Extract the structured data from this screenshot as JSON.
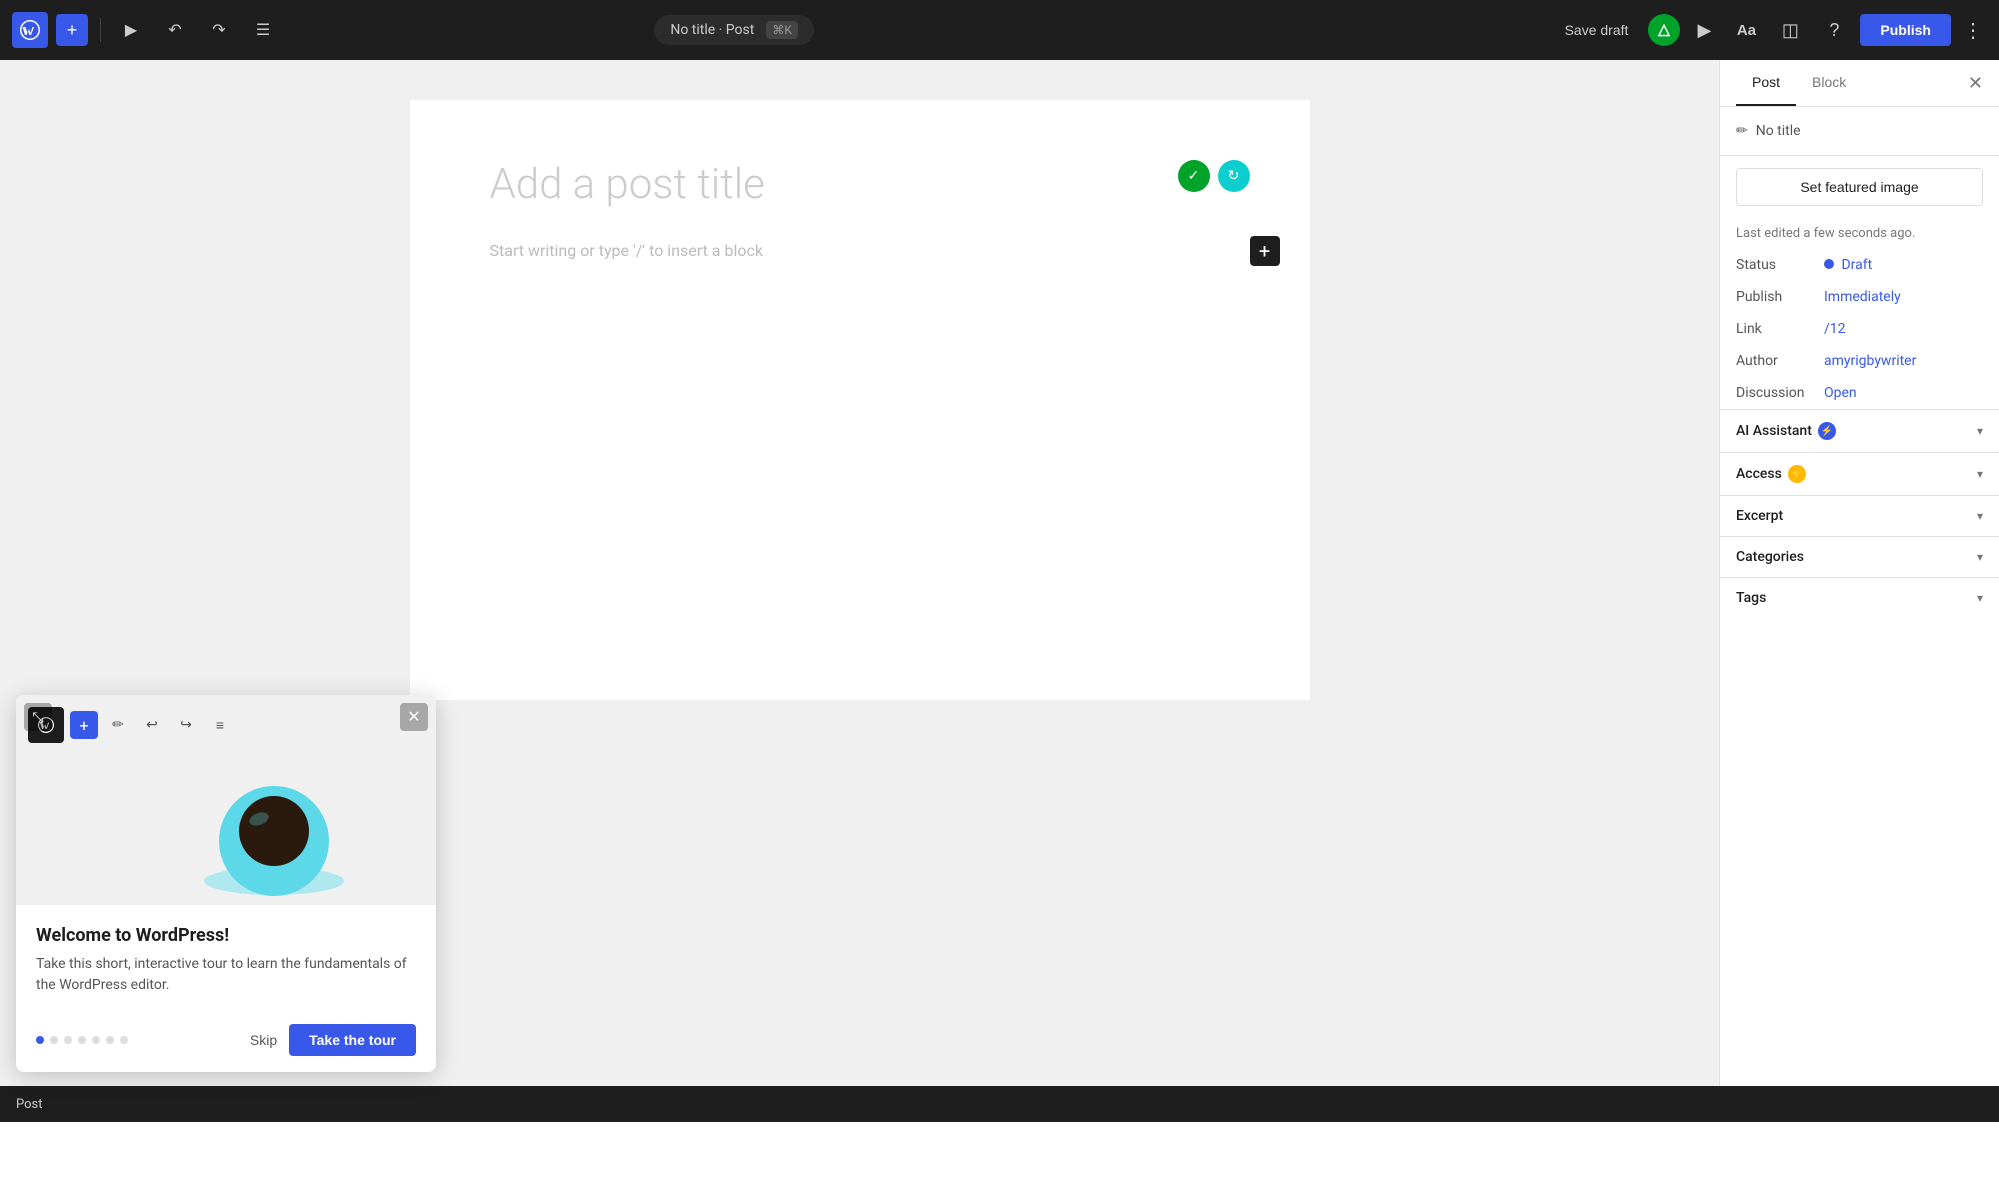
{
  "toolbar": {
    "title": "No title · Post",
    "shortcut": "⌘K",
    "save_draft": "Save draft",
    "publish": "Publish"
  },
  "editor": {
    "title_placeholder": "Add a post title",
    "block_placeholder": "Start writing or type '/' to insert a block"
  },
  "sidebar": {
    "tab_post": "Post",
    "tab_block": "Block",
    "post_title": "No title",
    "featured_image_btn": "Set featured image",
    "last_edited": "Last edited a few seconds ago.",
    "status_label": "Status",
    "status_value": "Draft",
    "publish_label": "Publish",
    "publish_value": "Immediately",
    "link_label": "Link",
    "link_value": "/12",
    "author_label": "Author",
    "author_value": "amyrigbywriter",
    "discussion_label": "Discussion",
    "discussion_value": "Open",
    "ai_assistant_label": "AI Assistant",
    "access_label": "Access",
    "excerpt_label": "Excerpt",
    "categories_label": "Categories",
    "tags_label": "Tags"
  },
  "welcome_popup": {
    "title": "Welcome to WordPress!",
    "description": "Take this short, interactive tour to learn the fundamentals of the WordPress editor.",
    "skip_label": "Skip",
    "take_tour_label": "Take the tour",
    "dots": [
      true,
      false,
      false,
      false,
      false,
      false,
      false
    ]
  },
  "status_bar": {
    "label": "Post"
  }
}
